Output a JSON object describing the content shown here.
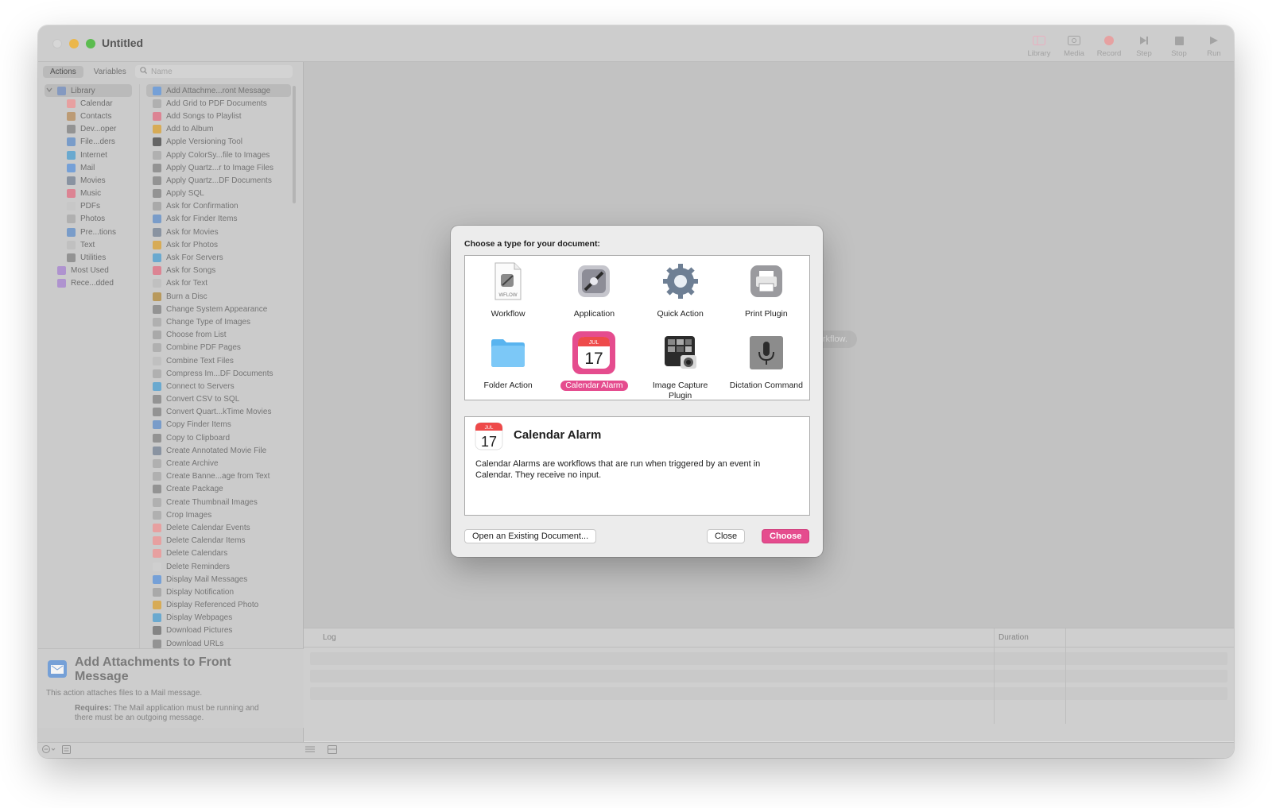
{
  "window": {
    "title": "Untitled"
  },
  "toolbar": [
    {
      "label": "Library",
      "icon": "library-icon"
    },
    {
      "label": "Media",
      "icon": "media-icon"
    },
    {
      "label": "Record",
      "icon": "record-icon"
    },
    {
      "label": "Step",
      "icon": "step-icon"
    },
    {
      "label": "Stop",
      "icon": "stop-icon"
    },
    {
      "label": "Run",
      "icon": "run-icon"
    }
  ],
  "sidebar": {
    "tabs": [
      "Actions",
      "Variables"
    ],
    "search_placeholder": "Name",
    "library": [
      {
        "label": "Library",
        "color": "#8aa0c8",
        "level": 0,
        "disclosure": true
      },
      {
        "label": "Calendar",
        "color": "#f1a7a7",
        "level": 1
      },
      {
        "label": "Contacts",
        "color": "#c4a27a",
        "level": 1
      },
      {
        "label": "Dev...oper",
        "color": "#9a9a9a",
        "level": 1
      },
      {
        "label": "File...ders",
        "color": "#7ea3d2",
        "level": 1
      },
      {
        "label": "Internet",
        "color": "#6fb0d8",
        "level": 1
      },
      {
        "label": "Mail",
        "color": "#7aa7e0",
        "level": 1
      },
      {
        "label": "Movies",
        "color": "#8f9aa8",
        "level": 1
      },
      {
        "label": "Music",
        "color": "#e58a9a",
        "level": 1
      },
      {
        "label": "PDFs",
        "color": "#d0d0d0",
        "level": 1
      },
      {
        "label": "Photos",
        "color": "#b8b8b8",
        "level": 1
      },
      {
        "label": "Pre...tions",
        "color": "#7ea3d2",
        "level": 1
      },
      {
        "label": "Text",
        "color": "#c8c8c8",
        "level": 1
      },
      {
        "label": "Utilities",
        "color": "#9a9a9a",
        "level": 1
      },
      {
        "label": "Most Used",
        "color": "#b79ad8",
        "level": 0
      },
      {
        "label": "Rece...dded",
        "color": "#b79ad8",
        "level": 0
      }
    ],
    "actions": [
      "Add Attachme...ront Message",
      "Add Grid to PDF Documents",
      "Add Songs to Playlist",
      "Add to Album",
      "Apple Versioning Tool",
      "Apply ColorSy...file to Images",
      "Apply Quartz...r to Image Files",
      "Apply Quartz...DF Documents",
      "Apply SQL",
      "Ask for Confirmation",
      "Ask for Finder Items",
      "Ask for Movies",
      "Ask for Photos",
      "Ask For Servers",
      "Ask for Songs",
      "Ask for Text",
      "Burn a Disc",
      "Change System Appearance",
      "Change Type of Images",
      "Choose from List",
      "Combine PDF Pages",
      "Combine Text Files",
      "Compress Im...DF Documents",
      "Connect to Servers",
      "Convert CSV to SQL",
      "Convert Quart...kTime Movies",
      "Copy Finder Items",
      "Copy to Clipboard",
      "Create Annotated Movie File",
      "Create Archive",
      "Create Banne...age from Text",
      "Create Package",
      "Create Thumbnail Images",
      "Crop Images",
      "Delete Calendar Events",
      "Delete Calendar Items",
      "Delete Calendars",
      "Delete Reminders",
      "Display Mail Messages",
      "Display Notification",
      "Display Referenced Photo",
      "Display Webpages",
      "Download Pictures",
      "Download URLs"
    ],
    "action_colors": [
      "#7aa7e0",
      "#b8b8b8",
      "#e58a9a",
      "#e0b25a",
      "#6a6a6a",
      "#b8b8b8",
      "#9a9a9a",
      "#9a9a9a",
      "#9a9a9a",
      "#b0b0b0",
      "#7ea3d2",
      "#8f9aa8",
      "#e0b25a",
      "#6fb0d8",
      "#e58a9a",
      "#c8c8c8",
      "#c0a060",
      "#9a9a9a",
      "#b8b8b8",
      "#b0b0b0",
      "#b8b8b8",
      "#c8c8c8",
      "#b8b8b8",
      "#6fb0d8",
      "#9a9a9a",
      "#9a9a9a",
      "#7ea3d2",
      "#9a9a9a",
      "#8f9aa8",
      "#b8b8b8",
      "#b8b8b8",
      "#9a9a9a",
      "#b8b8b8",
      "#b8b8b8",
      "#f1a7a7",
      "#f1a7a7",
      "#f1a7a7",
      "#d8d8d8",
      "#7aa7e0",
      "#b0b0b0",
      "#e0b25a",
      "#6fb0d8",
      "#8a8a8a",
      "#9a9a9a"
    ],
    "selected_action": 0,
    "description": {
      "title": "Add Attachments to Front Message",
      "text": "This action attaches files to a Mail message.",
      "requires_label": "Requires:",
      "requires_text": "The Mail application must be running and there must be an outgoing message."
    }
  },
  "canvas": {
    "hint": "r workflow."
  },
  "log": {
    "col_log": "Log",
    "col_duration": "Duration"
  },
  "dialog": {
    "title": "Choose a type for your document:",
    "types": [
      {
        "label": "Workflow",
        "icon": "workflow-icon"
      },
      {
        "label": "Application",
        "icon": "application-icon"
      },
      {
        "label": "Quick Action",
        "icon": "quick-action-icon"
      },
      {
        "label": "Print Plugin",
        "icon": "print-plugin-icon"
      },
      {
        "label": "Folder Action",
        "icon": "folder-icon"
      },
      {
        "label": "Calendar Alarm",
        "icon": "calendar-icon",
        "selected": true
      },
      {
        "label": "Image Capture Plugin",
        "icon": "image-capture-icon"
      },
      {
        "label": "Dictation Command",
        "icon": "microphone-icon"
      }
    ],
    "calendar_month": "JUL",
    "calendar_day": "17",
    "workflow_badge": "WFLOW",
    "info_title": "Calendar Alarm",
    "info_text": "Calendar Alarms are workflows that are run when triggered by an event in Calendar. They receive no input.",
    "buttons": {
      "open": "Open an Existing Document...",
      "close": "Close",
      "choose": "Choose"
    },
    "accent": "#e54c8e"
  }
}
